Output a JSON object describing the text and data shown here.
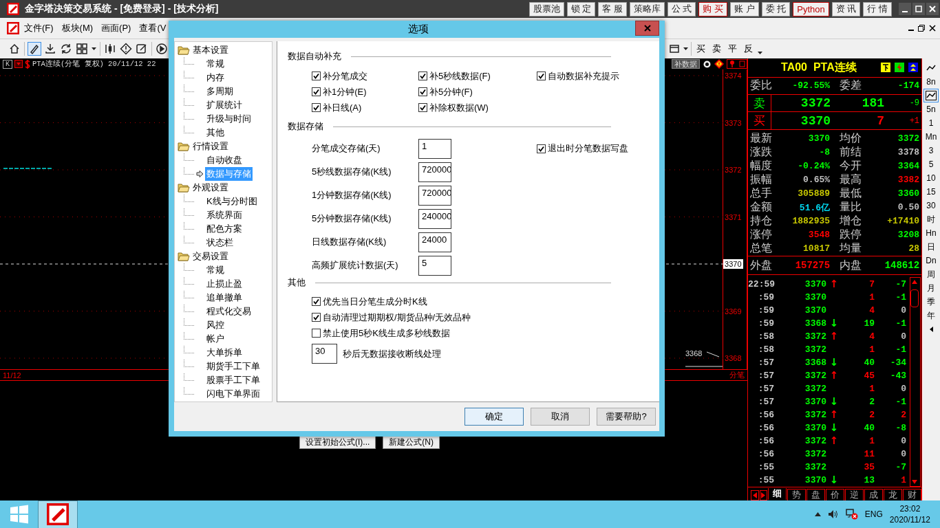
{
  "app": {
    "title": "金字塔决策交易系统 - [免费登录] - [技术分析]"
  },
  "title_buttons": [
    {
      "label": "股票池",
      "kind": "plain"
    },
    {
      "label": "锁 定",
      "kind": "plain"
    },
    {
      "label": "客 服",
      "kind": "plain"
    },
    {
      "label": "策略库",
      "kind": "plain"
    },
    {
      "label": "公 式",
      "kind": "plain"
    },
    {
      "label": "购 买",
      "kind": "accent"
    },
    {
      "label": "账 户",
      "kind": "plain"
    },
    {
      "label": "委 托",
      "kind": "plain"
    },
    {
      "label": "Python",
      "kind": "accent"
    },
    {
      "label": "资 讯",
      "kind": "plain"
    },
    {
      "label": "行 情",
      "kind": "plain"
    }
  ],
  "menu": [
    "文件(F)",
    "板块(M)",
    "画面(P)",
    "查看(V"
  ],
  "trade_toolbar": [
    "买",
    "卖",
    "平",
    "反"
  ],
  "chart": {
    "k_label": "K",
    "header": "PTA连续(分笔 复权) 20/11/12 22",
    "fill_button": "补数据",
    "price_ticks": [
      {
        "label": "3374",
        "current": false
      },
      {
        "label": "3373",
        "current": false
      },
      {
        "label": "3372",
        "current": false
      },
      {
        "label": "3371",
        "current": false
      },
      {
        "label": "3370",
        "current": true
      },
      {
        "label": "3369",
        "current": false
      },
      {
        "label": "3368",
        "current": false
      }
    ],
    "last_label": "3368",
    "date": "11/12",
    "mode": "分笔"
  },
  "formula_buttons": [
    "设置初始公式(I)...",
    "新建公式(N)"
  ],
  "quote": {
    "title": "TA00  PTA连续",
    "ratio": [
      {
        "label": "委比",
        "value": "-92.55%",
        "color": "#00ff00"
      },
      {
        "label": "委差",
        "value": "-174",
        "color": "#00ff00"
      }
    ],
    "book": [
      {
        "kind": "sell",
        "label": "卖",
        "price": "3372",
        "volume": "181",
        "change": "-9"
      },
      {
        "kind": "buy",
        "label": "买",
        "price": "3370",
        "volume": "7",
        "change": "+1"
      }
    ],
    "stats": [
      {
        "label": "最新",
        "value": "3370",
        "color": "#00ff00"
      },
      {
        "label": "均价",
        "value": "3372",
        "color": "#00ff00"
      },
      {
        "label": "涨跌",
        "value": "-8",
        "color": "#00ff00"
      },
      {
        "label": "前结",
        "value": "3378",
        "color": "#c0c0c0"
      },
      {
        "label": "幅度",
        "value": "-0.24%",
        "color": "#00ff00"
      },
      {
        "label": "今开",
        "value": "3364",
        "color": "#00ff00"
      },
      {
        "label": "振幅",
        "value": "0.65%",
        "color": "#c0c0c0"
      },
      {
        "label": "最高",
        "value": "3382",
        "color": "#ff0000"
      },
      {
        "label": "总手",
        "value": "305889",
        "color": "#c8c800"
      },
      {
        "label": "最低",
        "value": "3360",
        "color": "#00ff00"
      },
      {
        "label": "金额",
        "value": "51.6亿",
        "color": "#00d8f0"
      },
      {
        "label": "量比",
        "value": "0.50",
        "color": "#c0c0c0"
      },
      {
        "label": "持仓",
        "value": "1882935",
        "color": "#c8c800"
      },
      {
        "label": "增仓",
        "value": "+17410",
        "color": "#c8c800"
      },
      {
        "label": "涨停",
        "value": "3548",
        "color": "#ff0000"
      },
      {
        "label": "跌停",
        "value": "3208",
        "color": "#00ff00"
      },
      {
        "label": "总笔",
        "value": "10817",
        "color": "#c8c800"
      },
      {
        "label": "均量",
        "value": "28",
        "color": "#c8c800"
      }
    ],
    "outer_inner": [
      {
        "label": "外盘",
        "value": "157275",
        "color": "#ff0000"
      },
      {
        "label": "内盘",
        "value": "148612",
        "color": "#00ff00"
      }
    ],
    "ticks": [
      {
        "time": "22:59",
        "price": "3370",
        "arrow": {
          "text": "↑",
          "color": "#ff0000"
        },
        "volume": {
          "text": "7",
          "color": "#ff0000"
        },
        "change": {
          "text": "-7",
          "color": "#00ff00"
        }
      },
      {
        "time": ":59",
        "price": "3370",
        "volume": {
          "text": "1",
          "color": "#ff0000"
        },
        "change": {
          "text": "-1",
          "color": "#00ff00"
        }
      },
      {
        "time": ":59",
        "price": "3370",
        "volume": {
          "text": "4",
          "color": "#ff0000"
        },
        "change": {
          "text": "0",
          "color": "#c0c0c0"
        }
      },
      {
        "time": ":59",
        "price": "3368",
        "arrow": {
          "text": "↓",
          "color": "#00ff00"
        },
        "volume": {
          "text": "19",
          "color": "#00ff00"
        },
        "change": {
          "text": "-1",
          "color": "#00ff00"
        }
      },
      {
        "time": ":58",
        "price": "3372",
        "arrow": {
          "text": "↑",
          "color": "#ff0000"
        },
        "volume": {
          "text": "4",
          "color": "#ff0000"
        },
        "change": {
          "text": "0",
          "color": "#c0c0c0"
        }
      },
      {
        "time": ":58",
        "price": "3372",
        "volume": {
          "text": "1",
          "color": "#ff0000"
        },
        "change": {
          "text": "-1",
          "color": "#00ff00"
        }
      },
      {
        "time": ":57",
        "price": "3368",
        "arrow": {
          "text": "↓",
          "color": "#00ff00"
        },
        "volume": {
          "text": "40",
          "color": "#00ff00"
        },
        "change": {
          "text": "-34",
          "color": "#00ff00"
        }
      },
      {
        "time": ":57",
        "price": "3372",
        "arrow": {
          "text": "↑",
          "color": "#ff0000"
        },
        "volume": {
          "text": "45",
          "color": "#ff0000"
        },
        "change": {
          "text": "-43",
          "color": "#00ff00"
        }
      },
      {
        "time": ":57",
        "price": "3372",
        "volume": {
          "text": "1",
          "color": "#ff0000"
        },
        "change": {
          "text": "0",
          "color": "#c0c0c0"
        }
      },
      {
        "time": ":57",
        "price": "3370",
        "arrow": {
          "text": "↓",
          "color": "#00ff00"
        },
        "volume": {
          "text": "2",
          "color": "#00ff00"
        },
        "change": {
          "text": "-1",
          "color": "#00ff00"
        }
      },
      {
        "time": ":56",
        "price": "3372",
        "arrow": {
          "text": "↑",
          "color": "#ff0000"
        },
        "volume": {
          "text": "2",
          "color": "#ff0000"
        },
        "change": {
          "text": "2",
          "color": "#ff0000"
        }
      },
      {
        "time": ":56",
        "price": "3370",
        "arrow": {
          "text": "↓",
          "color": "#00ff00"
        },
        "volume": {
          "text": "40",
          "color": "#00ff00"
        },
        "change": {
          "text": "-8",
          "color": "#00ff00"
        }
      },
      {
        "time": ":56",
        "price": "3372",
        "arrow": {
          "text": "↑",
          "color": "#ff0000"
        },
        "volume": {
          "text": "1",
          "color": "#ff0000"
        },
        "change": {
          "text": "0",
          "color": "#c0c0c0"
        }
      },
      {
        "time": ":56",
        "price": "3372",
        "volume": {
          "text": "11",
          "color": "#ff0000"
        },
        "change": {
          "text": "0",
          "color": "#c0c0c0"
        }
      },
      {
        "time": ":55",
        "price": "3372",
        "volume": {
          "text": "35",
          "color": "#ff0000"
        },
        "change": {
          "text": "-7",
          "color": "#00ff00"
        }
      },
      {
        "time": ":55",
        "price": "3370",
        "arrow": {
          "text": "↓",
          "color": "#00ff00"
        },
        "volume": {
          "text": "13",
          "color": "#00ff00"
        },
        "change": {
          "text": "1",
          "color": "#ff0000"
        }
      }
    ],
    "tabs": [
      {
        "label": "细",
        "selected": true
      },
      {
        "label": "势",
        "selected": false
      },
      {
        "label": "盘",
        "selected": false
      },
      {
        "label": "价",
        "selected": false
      },
      {
        "label": "逆",
        "selected": false
      },
      {
        "label": "成",
        "selected": false
      },
      {
        "label": "龙",
        "selected": false
      },
      {
        "label": "财",
        "selected": false
      }
    ]
  },
  "periods": [
    {
      "kind": "icon",
      "selected": false
    },
    {
      "kind": "text",
      "label": "8n",
      "selected": false
    },
    {
      "kind": "icon",
      "selected": true
    },
    {
      "kind": "text",
      "label": "5n",
      "selected": false
    },
    {
      "kind": "text",
      "label": "1",
      "selected": false
    },
    {
      "kind": "text",
      "label": "Mn",
      "selected": false
    },
    {
      "kind": "text",
      "label": "3",
      "selected": false
    },
    {
      "kind": "text",
      "label": "5",
      "selected": false
    },
    {
      "kind": "text",
      "label": "10",
      "selected": false
    },
    {
      "kind": "text",
      "label": "15",
      "selected": false
    },
    {
      "kind": "text",
      "label": "30",
      "selected": false
    },
    {
      "kind": "text",
      "label": "时",
      "selected": false
    },
    {
      "kind": "text",
      "label": "Hn",
      "selected": false
    },
    {
      "kind": "text",
      "label": "日",
      "selected": false
    },
    {
      "kind": "text",
      "label": "Dn",
      "selected": false
    },
    {
      "kind": "text",
      "label": "周",
      "selected": false
    },
    {
      "kind": "text",
      "label": "月",
      "selected": false
    },
    {
      "kind": "text",
      "label": "季",
      "selected": false
    },
    {
      "kind": "text",
      "label": "年",
      "selected": false
    },
    {
      "kind": "arrow",
      "selected": false
    }
  ],
  "dialog": {
    "title": "选项",
    "tree": [
      {
        "label": "基本设置",
        "children": [
          {
            "label": "常规",
            "selected": false
          },
          {
            "label": "内存",
            "selected": false
          },
          {
            "label": "多周期",
            "selected": false
          },
          {
            "label": "扩展统计",
            "selected": false
          },
          {
            "label": "升级与时间",
            "selected": false
          },
          {
            "label": "其他",
            "selected": false
          }
        ]
      },
      {
        "label": "行情设置",
        "children": [
          {
            "label": "自动收盘",
            "selected": false
          },
          {
            "label": "数据与存储",
            "selected": true
          }
        ]
      },
      {
        "label": "外观设置",
        "children": [
          {
            "label": "K线与分时图",
            "selected": false
          },
          {
            "label": "系统界面",
            "selected": false
          },
          {
            "label": "配色方案",
            "selected": false
          },
          {
            "label": "状态栏",
            "selected": false
          }
        ]
      },
      {
        "label": "交易设置",
        "children": [
          {
            "label": "常规",
            "selected": false
          },
          {
            "label": "止损止盈",
            "selected": false
          },
          {
            "label": "追单撤单",
            "selected": false
          },
          {
            "label": "程式化交易",
            "selected": false
          },
          {
            "label": "风控",
            "selected": false
          },
          {
            "label": "帐户",
            "selected": false
          },
          {
            "label": "大单拆单",
            "selected": false
          },
          {
            "label": "期货手工下单",
            "selected": false
          },
          {
            "label": "股票手工下单",
            "selected": false
          },
          {
            "label": "闪电下单界面",
            "selected": false
          }
        ]
      }
    ],
    "auto_fill": {
      "heading": "数据自动补充",
      "rows": [
        [
          {
            "label": "补分笔成交",
            "checked": true
          },
          {
            "label": "补5秒线数据(F)",
            "checked": true
          },
          {
            "label": "自动数据补充提示",
            "checked": true
          }
        ],
        [
          {
            "label": "补1分钟(E)",
            "checked": true
          },
          {
            "label": "补5分钟(F)",
            "checked": true
          }
        ],
        [
          {
            "label": "补日线(A)",
            "checked": true
          },
          {
            "label": "补除权数据(W)",
            "checked": true
          }
        ]
      ]
    },
    "storage": {
      "heading": "数据存储",
      "fields": [
        {
          "label": "分笔成交存储(天)",
          "value": "1"
        },
        {
          "label": "5秒线数据存储(K线)",
          "value": "720000"
        },
        {
          "label": "1分钟数据存储(K线)",
          "value": "720000"
        },
        {
          "label": "5分钟数据存储(K线)",
          "value": "240000"
        },
        {
          "label": "日线数据存储(K线)",
          "value": "24000"
        },
        {
          "label": "高频扩展统计数据(天)",
          "value": "5"
        }
      ],
      "option": {
        "label": "退出时分笔数据写盘",
        "checked": true
      }
    },
    "other": {
      "heading": "其他",
      "options": [
        {
          "label": "优先当日分笔生成分时K线",
          "checked": true
        },
        {
          "label": "自动清理过期期权/期货品种/无效品种",
          "checked": true
        },
        {
          "label": "禁止使用5秒K线生成多秒线数据",
          "checked": false
        }
      ],
      "timeout": {
        "value": "30",
        "label": "秒后无数据接收断线处理"
      }
    },
    "buttons": [
      {
        "label": "确定",
        "kind": "default"
      },
      {
        "label": "取消",
        "kind": "normal"
      },
      {
        "label": "需要帮助?",
        "kind": "normal"
      }
    ]
  },
  "taskbar": {
    "language": "ENG",
    "time": "23:02",
    "date": "2020/11/12"
  }
}
